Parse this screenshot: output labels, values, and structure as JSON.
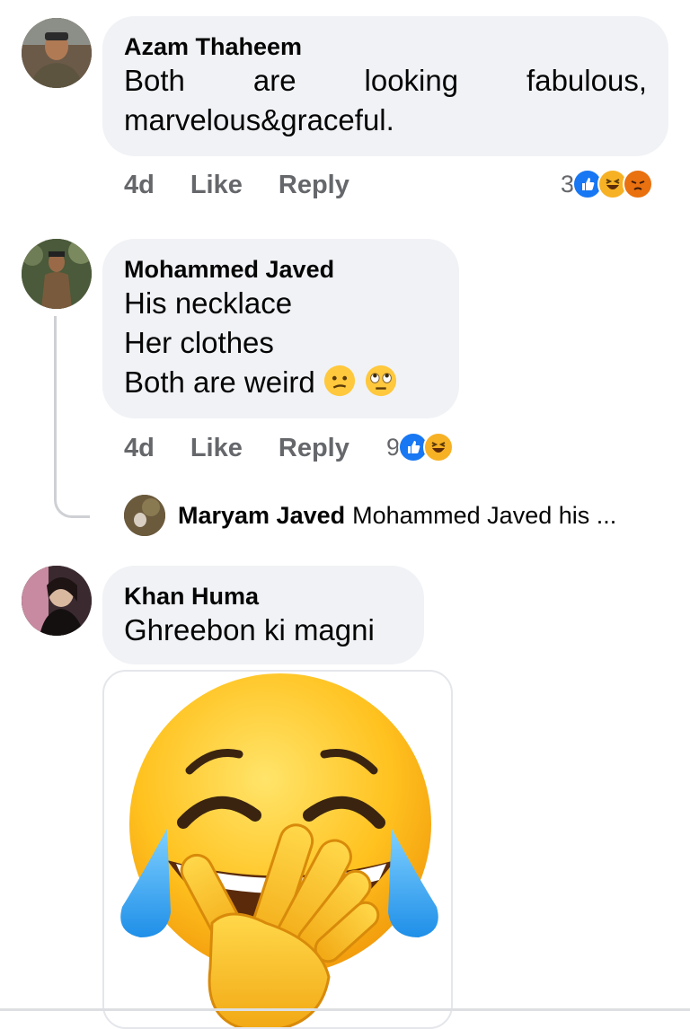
{
  "comments": [
    {
      "author": "Azam Thaheem",
      "text": "Both are looking fabulous, marvelous&graceful.",
      "time": "4d",
      "like_label": "Like",
      "reply_label": "Reply",
      "reaction_count": "3",
      "reactions": [
        "like-icon",
        "haha-icon",
        "angry-icon"
      ]
    },
    {
      "author": "Mohammed Javed",
      "lines": [
        "His necklace",
        "Her clothes",
        "Both are weird"
      ],
      "emojis": [
        "confused-face-icon",
        "rolling-eyes-icon"
      ],
      "time": "4d",
      "like_label": "Like",
      "reply_label": "Reply",
      "reaction_count": "9",
      "reactions": [
        "like-icon",
        "haha-icon"
      ],
      "reply_preview": {
        "author": "Maryam Javed",
        "text": "Mohammed Javed his ..."
      }
    },
    {
      "author": "Khan Huma",
      "text": "Ghreebon ki magni",
      "attachment": "laughing-crying-emoji-image"
    }
  ],
  "colors": {
    "bubble": "#f0f2f5",
    "meta_text": "#65676b",
    "like_blue": "#1877f2",
    "haha_yellow": "#f7b125",
    "angry_orange": "#e9710f"
  }
}
